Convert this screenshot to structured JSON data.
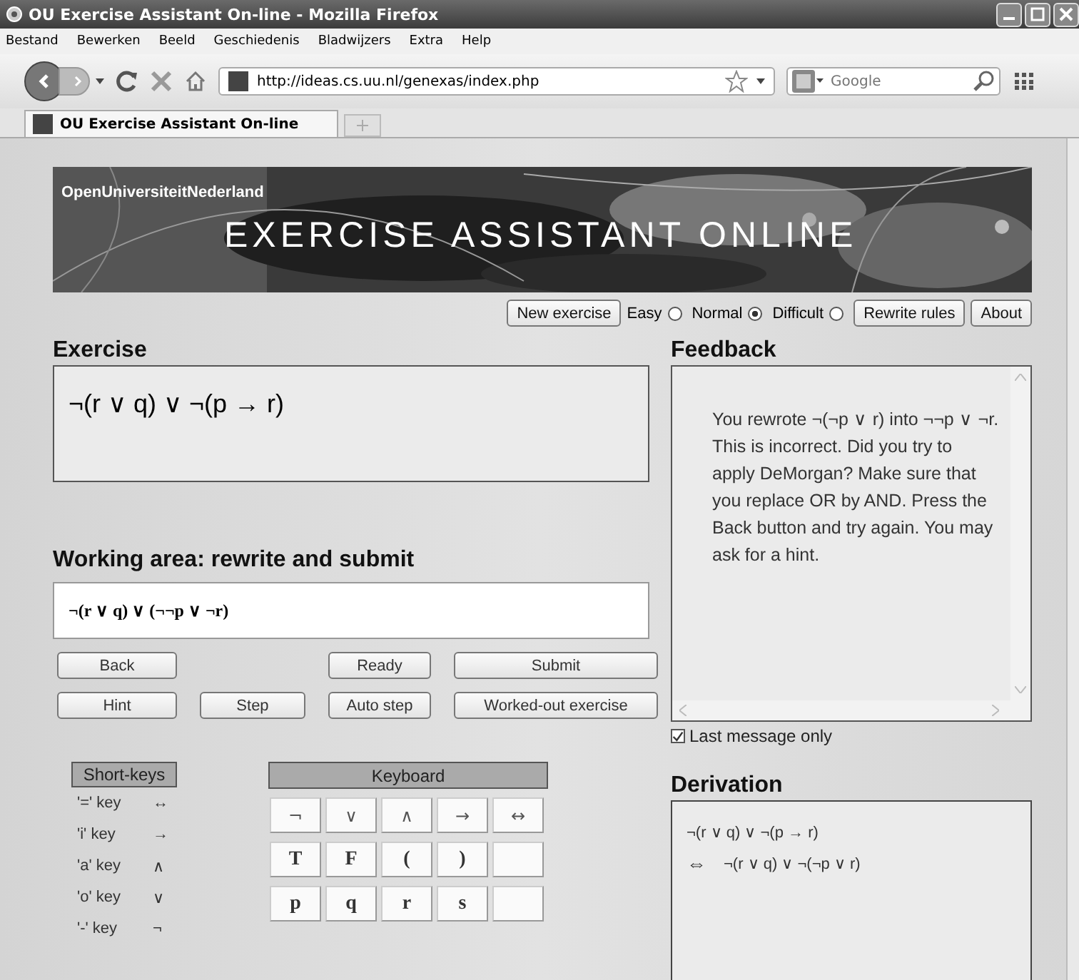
{
  "window": {
    "title": "OU Exercise Assistant On-line - Mozilla Firefox"
  },
  "menu": [
    "Bestand",
    "Bewerken",
    "Beeld",
    "Geschiedenis",
    "Bladwijzers",
    "Extra",
    "Help"
  ],
  "address": {
    "url": "http://ideas.cs.uu.nl/genexas/index.php"
  },
  "search": {
    "placeholder": "Google"
  },
  "tabs": [
    {
      "label": "OU Exercise Assistant On-line",
      "selected": true
    }
  ],
  "banner": {
    "org": "OpenUniversiteitNederland",
    "title": "EXERCISE ASSISTANT ONLINE"
  },
  "header_controls": [
    {
      "kind": "button",
      "label": "New exercise"
    },
    {
      "kind": "radio",
      "label": "Easy",
      "selected": false
    },
    {
      "kind": "radio",
      "label": "Normal",
      "selected": true
    },
    {
      "kind": "radio",
      "label": "Difficult",
      "selected": false
    },
    {
      "kind": "button",
      "label": "Rewrite rules"
    },
    {
      "kind": "button",
      "label": "About"
    }
  ],
  "exercise": {
    "heading": "Exercise",
    "formula": "¬(r ∨ q) ∨ ¬(p → r)"
  },
  "working_area": {
    "heading": "Working area: rewrite and submit",
    "value": "¬(r ∨ q) ∨ (¬¬p ∨ ¬r)",
    "button_rows": [
      [
        "Back",
        "Ready",
        "Submit"
      ],
      [
        "Hint",
        "Step",
        "Auto step",
        "Worked-out exercise"
      ]
    ]
  },
  "short_keys": {
    "heading": "Short-keys",
    "rows": [
      {
        "key": "'=' key",
        "symbol": "↔"
      },
      {
        "key": "'i'  key",
        "symbol": "→"
      },
      {
        "key": "'a' key",
        "symbol": "∧"
      },
      {
        "key": "'o' key",
        "symbol": "∨"
      },
      {
        "key": "'-' key",
        "symbol": "¬"
      }
    ]
  },
  "keyboard": {
    "heading": "Keyboard",
    "rows": [
      [
        {
          "kind": "operator",
          "label": "¬"
        },
        {
          "kind": "operator",
          "label": "∨"
        },
        {
          "kind": "operator",
          "label": "∧"
        },
        {
          "kind": "operator",
          "label": "→"
        },
        {
          "kind": "operator",
          "label": "↔"
        }
      ],
      [
        {
          "kind": "letter",
          "label": "T"
        },
        {
          "kind": "letter",
          "label": "F"
        },
        {
          "kind": "letter",
          "label": "("
        },
        {
          "kind": "letter",
          "label": ")"
        },
        {
          "kind": "blank"
        }
      ],
      [
        {
          "kind": "letter",
          "label": "p"
        },
        {
          "kind": "letter",
          "label": "q"
        },
        {
          "kind": "letter",
          "label": "r"
        },
        {
          "kind": "letter",
          "label": "s"
        },
        {
          "kind": "blank"
        }
      ]
    ]
  },
  "feedback": {
    "heading": "Feedback",
    "message": "You rewrote ¬(¬p ∨ r) into ¬¬p ∨ ¬r. This is incorrect. Did you try to apply DeMorgan? Make sure that you replace OR by AND. Press the Back button and try again. You may ask for a hint.",
    "last_message_only": {
      "label": "Last message only",
      "checked": true
    }
  },
  "derivation": {
    "heading": "Derivation",
    "lines": [
      {
        "kind": "start",
        "formula": "¬(r ∨ q) ∨ ¬(p → r)"
      },
      {
        "kind": "step",
        "symbol": "⇔",
        "formula": "¬(r ∨ q) ∨ ¬(¬p ∨ r)"
      }
    ]
  }
}
